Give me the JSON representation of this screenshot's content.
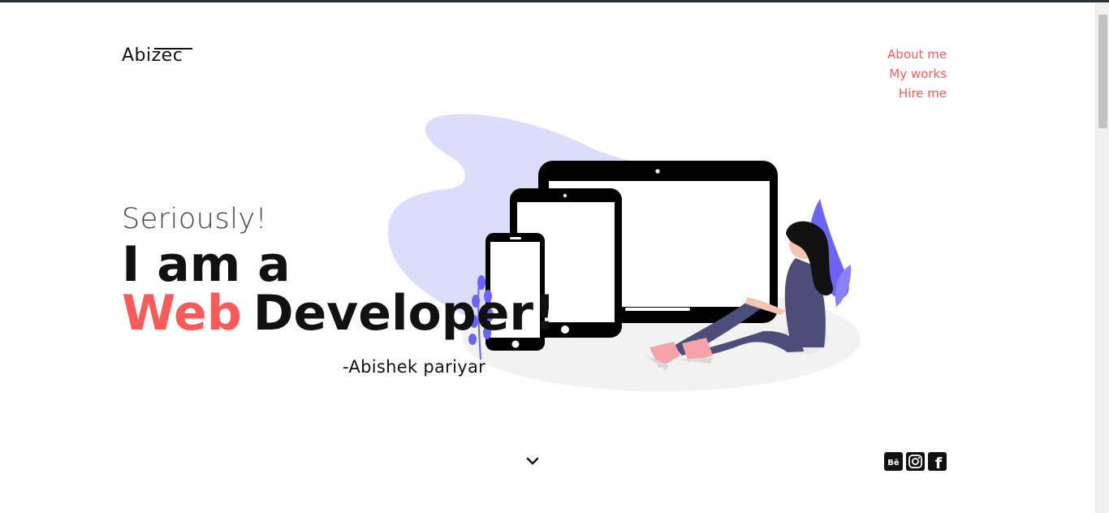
{
  "logo": {
    "text": "Abizec"
  },
  "nav": {
    "items": [
      {
        "label": "About me"
      },
      {
        "label": "My works"
      },
      {
        "label": "Hire me"
      }
    ]
  },
  "hero": {
    "subtitle": "Seriously!",
    "line1": "I am a",
    "accent_word": "Web",
    "line2_rest": "Developer!",
    "signature": "-Abishek pariyar"
  },
  "scroll_indicator": {
    "icon": "chevron-down-icon"
  },
  "socials": [
    {
      "icon": "behance-icon",
      "glyph": "Bē"
    },
    {
      "icon": "instagram-icon"
    },
    {
      "icon": "facebook-icon",
      "glyph": "f"
    }
  ],
  "colors": {
    "accent": "#ff5a5a",
    "text": "#111111",
    "blob": "#dcdcfb",
    "plant": "#6c63ff",
    "figure_outfit": "#4d4d7a",
    "shoes": "#f5a3a9"
  }
}
